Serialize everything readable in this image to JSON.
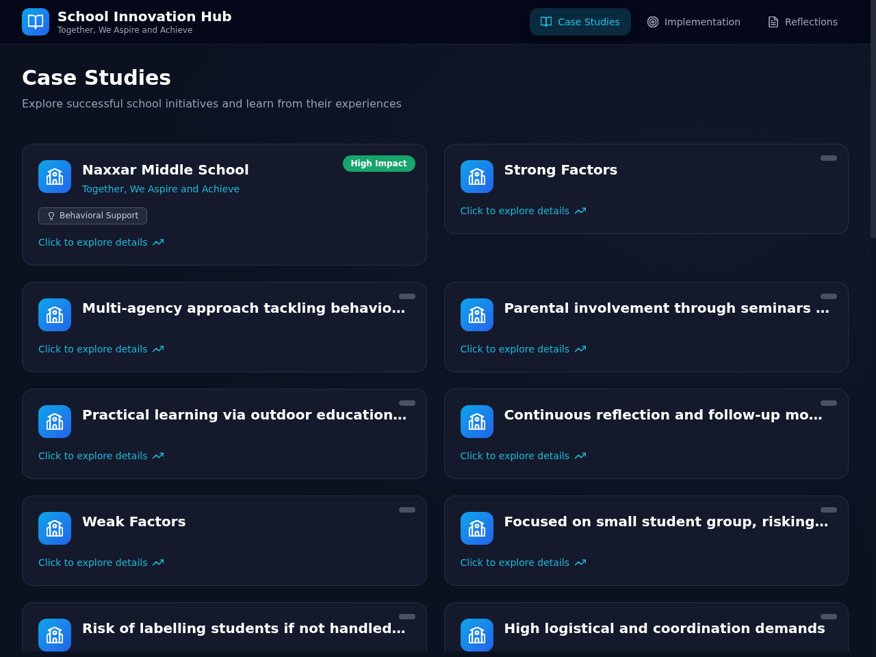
{
  "header": {
    "title": "School Innovation Hub",
    "subtitle": "Together, We Aspire and Achieve"
  },
  "nav": [
    {
      "label": "Case Studies",
      "selected": true
    },
    {
      "label": "Implementation",
      "selected": false
    },
    {
      "label": "Reflections",
      "selected": false
    }
  ],
  "page": {
    "title": "Case Studies",
    "subtitle": "Explore successful school initiatives and learn from their experiences"
  },
  "cards": [
    {
      "title": "Naxxar Middle School",
      "subtitle": "Together, We Aspire and Achieve",
      "tag": "Behavioral Support",
      "badge": {
        "kind": "label",
        "text": "High Impact"
      },
      "link": "Click to explore details"
    },
    {
      "title": "Strong Factors",
      "badge": {
        "kind": "blank"
      },
      "link": "Click to explore details"
    },
    {
      "title": "Multi-agency approach tackling behavio…",
      "badge": {
        "kind": "blank"
      },
      "link": "Click to explore details"
    },
    {
      "title": "Parental involvement through seminars …",
      "badge": {
        "kind": "blank"
      },
      "link": "Click to explore details"
    },
    {
      "title": "Practical learning via outdoor education…",
      "badge": {
        "kind": "blank"
      },
      "link": "Click to explore details"
    },
    {
      "title": "Continuous reflection and follow-up mo…",
      "badge": {
        "kind": "blank"
      },
      "link": "Click to explore details"
    },
    {
      "title": "Weak Factors",
      "badge": {
        "kind": "blank"
      },
      "link": "Click to explore details"
    },
    {
      "title": "Focused on small student group, risking…",
      "badge": {
        "kind": "blank"
      },
      "link": "Click to explore details"
    },
    {
      "title": "Risk of labelling students if not handled…",
      "badge": {
        "kind": "blank"
      }
    },
    {
      "title": "High logistical and coordination demands",
      "badge": {
        "kind": "blank"
      }
    }
  ]
}
